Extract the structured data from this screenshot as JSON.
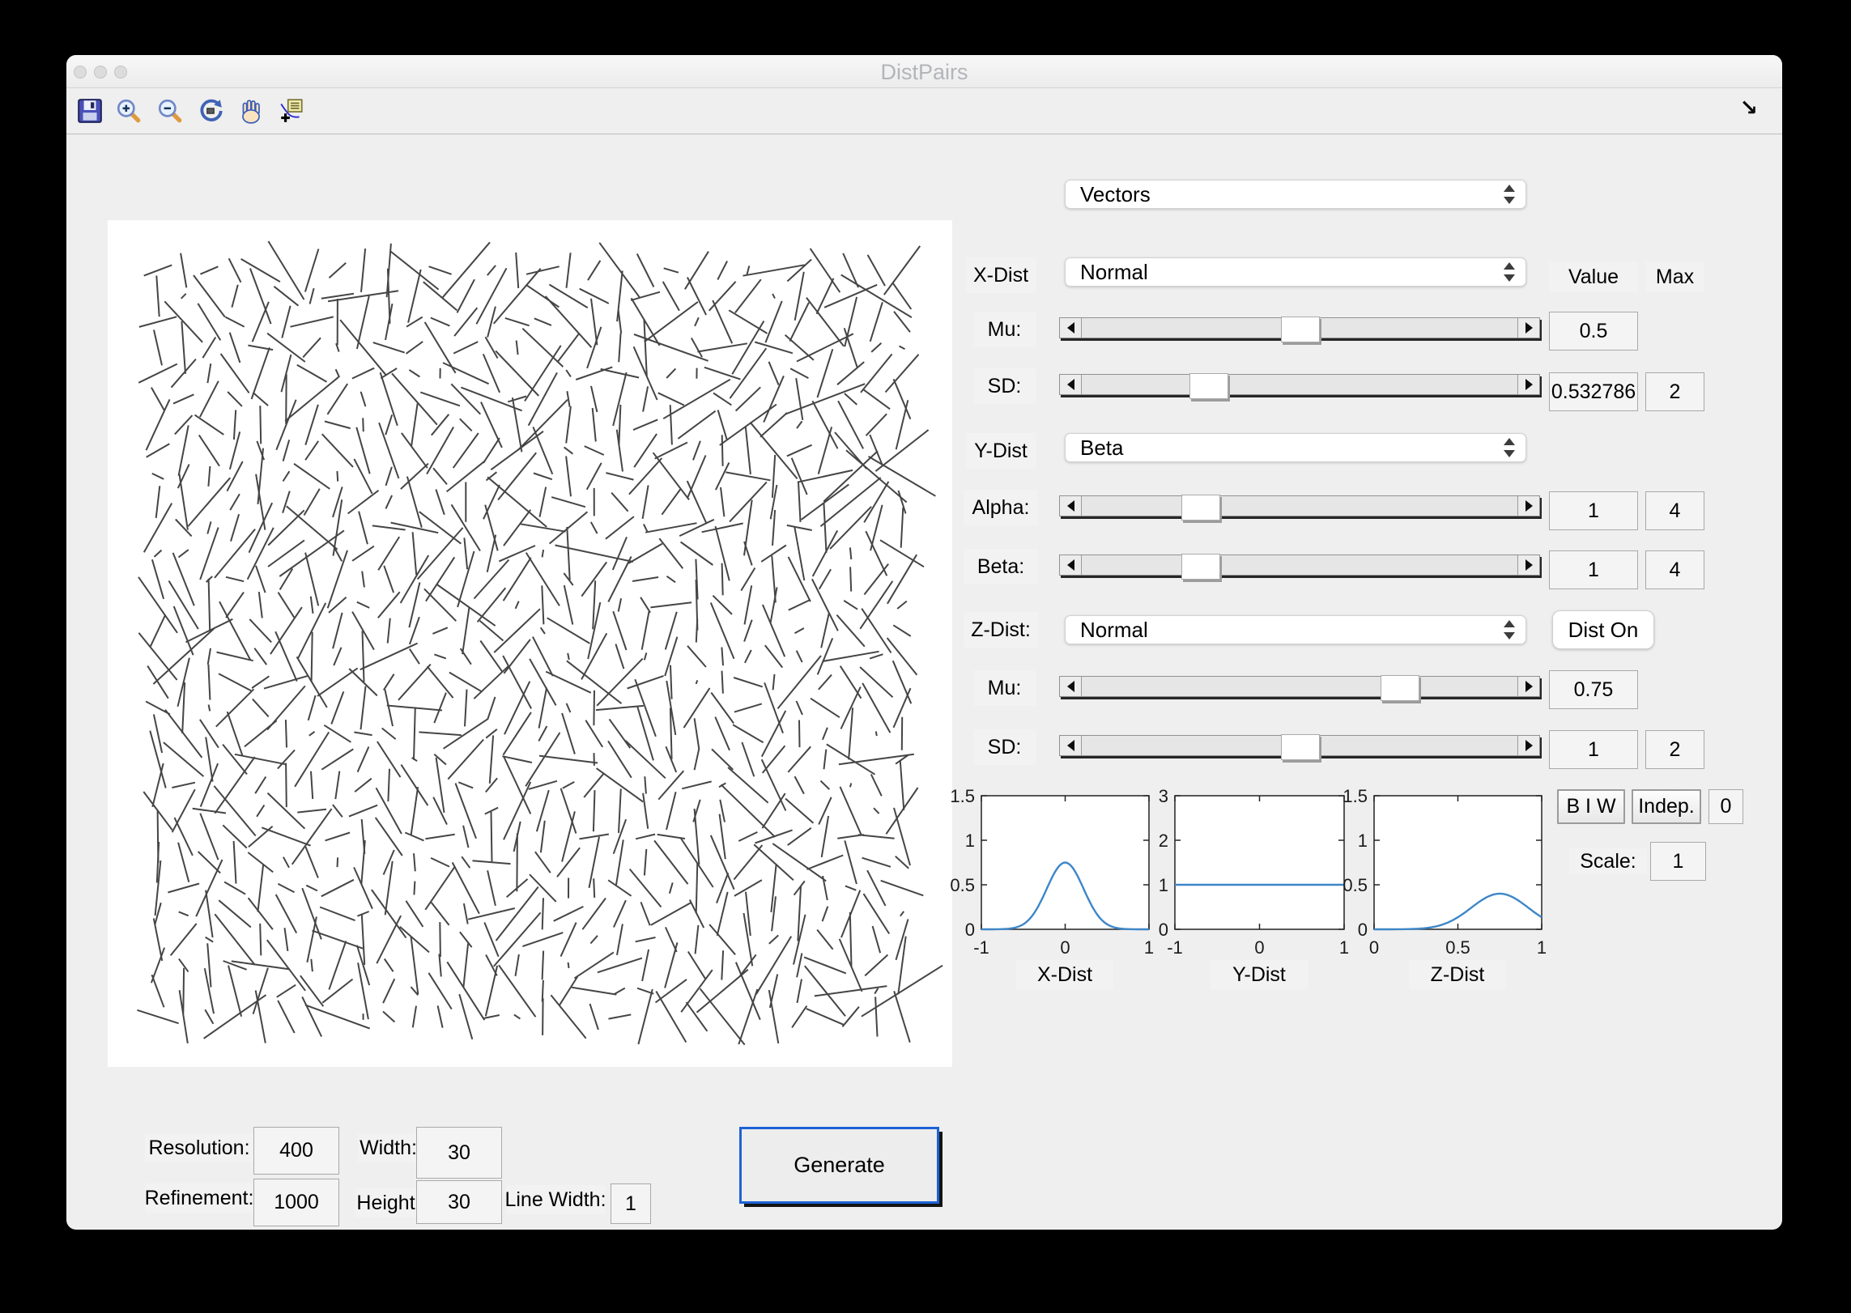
{
  "window": {
    "title": "DistPairs",
    "dock_arrow": "↘"
  },
  "toolbar": {
    "icons": [
      "save-icon",
      "zoom-in-icon",
      "zoom-out-icon",
      "rotate-3d-icon",
      "pan-hand-icon",
      "data-cursor-icon"
    ]
  },
  "controls": {
    "plot_type": {
      "value": "Vectors"
    },
    "headers": {
      "value": "Value",
      "max": "Max"
    },
    "x_dist": {
      "label": "X-Dist",
      "value": "Normal",
      "mu": {
        "label": "Mu:",
        "value": "0.5",
        "fraction": 0.5
      },
      "sd": {
        "label": "SD:",
        "value": "0.532786",
        "max": "2",
        "fraction": 0.27
      }
    },
    "y_dist": {
      "label": "Y-Dist",
      "value": "Beta",
      "alpha": {
        "label": "Alpha:",
        "value": "1",
        "max": "4",
        "fraction": 0.25
      },
      "beta": {
        "label": "Beta:",
        "value": "1",
        "max": "4",
        "fraction": 0.25
      }
    },
    "z_dist": {
      "label": "Z-Dist:",
      "value": "Normal",
      "dist_on_label": "Dist On",
      "mu": {
        "label": "Mu:",
        "value": "0.75",
        "fraction": 0.75
      },
      "sd": {
        "label": "SD:",
        "value": "1",
        "max": "2",
        "fraction": 0.5
      }
    },
    "bw_button": "B I W",
    "indep_button": "Indep.",
    "indep_value": "0",
    "scale": {
      "label": "Scale:",
      "value": "1"
    }
  },
  "bottom": {
    "resolution": {
      "label": "Resolution:",
      "value": "400"
    },
    "refinement": {
      "label": "Refinement:",
      "value": "1000"
    },
    "width": {
      "label": "Width:",
      "value": "30"
    },
    "height": {
      "label": "Height:",
      "value": "30"
    },
    "line_width": {
      "label": "Line Width:",
      "value": "1"
    },
    "generate_label": "Generate"
  },
  "chart_data": [
    {
      "type": "line",
      "xlabel": "X-Dist",
      "xlim": [
        -1,
        1
      ],
      "ylim": [
        0,
        1.5
      ],
      "xticks": [
        -1,
        0,
        1
      ],
      "yticks": [
        0,
        0.5,
        1,
        1.5
      ],
      "curve": {
        "shape": "gaussian",
        "mu": 0,
        "sigma": 0.22,
        "peak": 0.75
      },
      "line_color": "#3d86c8",
      "grid": false
    },
    {
      "type": "line",
      "xlabel": "Y-Dist",
      "xlim": [
        -1,
        1
      ],
      "ylim": [
        0,
        3
      ],
      "xticks": [
        -1,
        0,
        1
      ],
      "yticks": [
        0,
        1,
        2,
        3
      ],
      "curve": {
        "shape": "constant",
        "value": 1
      },
      "line_color": "#3d86c8",
      "grid": false
    },
    {
      "type": "line",
      "xlabel": "Z-Dist",
      "xlim": [
        0,
        1
      ],
      "ylim": [
        0,
        1.5
      ],
      "xticks": [
        0,
        0.5,
        1
      ],
      "yticks": [
        0,
        0.5,
        1,
        1.5
      ],
      "curve": {
        "shape": "gaussian",
        "mu": 0.75,
        "sigma": 0.17,
        "peak": 0.4
      },
      "line_color": "#3d86c8",
      "grid": false
    }
  ],
  "vector_field": {
    "grid": [
      30,
      30
    ],
    "seed": 9,
    "margin": 62,
    "half_length_scale": 36,
    "x_component": {
      "dist": "normal",
      "mu": 0,
      "sigma": 0.45
    },
    "y_component": {
      "dist": "uniform",
      "range": [
        0.05,
        1
      ]
    },
    "line_color": "#454545",
    "line_width": 2
  }
}
